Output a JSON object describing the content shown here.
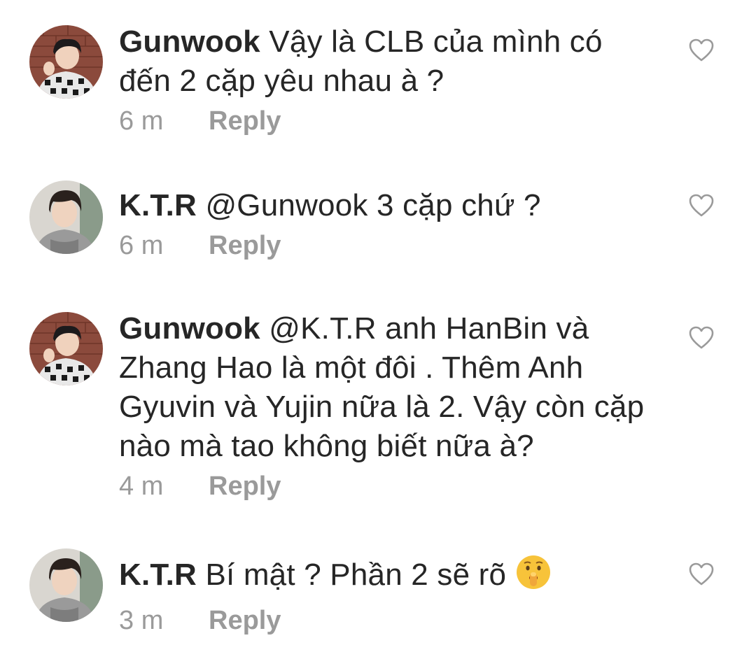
{
  "comments": [
    {
      "username": "Gunwook",
      "text": "Vậy là CLB của mình có đến 2 cặp yêu nhau à ?",
      "time": "6 m",
      "reply_label": "Reply",
      "avatar_icon": "avatar-gunwook",
      "like_icon": "heart-outline-icon"
    },
    {
      "username": "K.T.R",
      "text": "@Gunwook 3 cặp chứ ?",
      "time": "6 m",
      "reply_label": "Reply",
      "avatar_icon": "avatar-ktr",
      "like_icon": "heart-outline-icon"
    },
    {
      "username": "Gunwook",
      "text": "@K.T.R anh HanBin và Zhang Hao là một đôi . Thêm Anh Gyuvin và Yujin nữa là 2. Vậy còn cặp nào mà tao không biết nữa à?",
      "time": "4 m",
      "reply_label": "Reply",
      "avatar_icon": "avatar-gunwook",
      "like_icon": "heart-outline-icon"
    },
    {
      "username": "K.T.R",
      "text": "Bí mật ? Phần 2 sẽ rõ",
      "emoji": "shushing-face-emoji",
      "time": "3 m",
      "reply_label": "Reply",
      "avatar_icon": "avatar-ktr",
      "like_icon": "heart-outline-icon"
    }
  ],
  "colors": {
    "text": "#262626",
    "meta": "#9a9a9a",
    "heart": "#9a9a9a"
  }
}
